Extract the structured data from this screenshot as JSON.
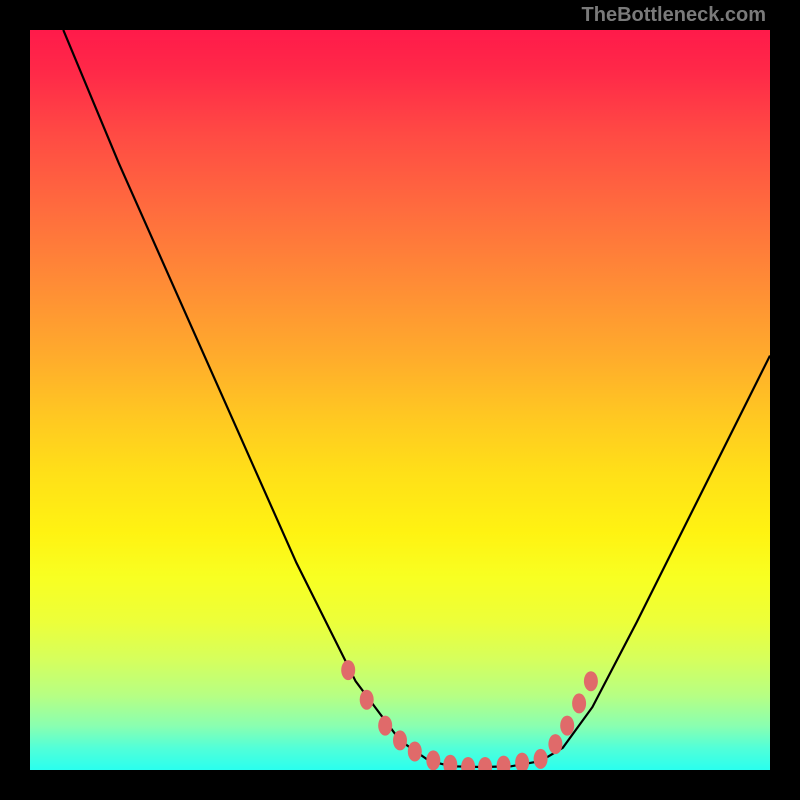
{
  "watermark": "TheBottleneck.com",
  "colors": {
    "frame": "#000000",
    "gradient_top": "#ff1a4a",
    "gradient_bottom": "#2affee",
    "curve": "#000000",
    "dot": "#e06a6a"
  },
  "chart_data": {
    "type": "line",
    "title": "",
    "xlabel": "",
    "ylabel": "",
    "xlim": [
      0,
      1
    ],
    "ylim": [
      0,
      1
    ],
    "note": "No axes or tick labels are visible; x and y are normalized to the plot area. y=1 is top of gradient, y=0 is bottom.",
    "series": [
      {
        "name": "curve",
        "x": [
          0.045,
          0.12,
          0.2,
          0.28,
          0.36,
          0.44,
          0.5,
          0.54,
          0.57,
          0.61,
          0.65,
          0.69,
          0.72,
          0.76,
          0.82,
          0.9,
          1.0
        ],
        "y": [
          1.0,
          0.82,
          0.64,
          0.46,
          0.28,
          0.12,
          0.04,
          0.012,
          0.005,
          0.004,
          0.005,
          0.012,
          0.03,
          0.085,
          0.2,
          0.36,
          0.56
        ]
      }
    ],
    "highlight_points": {
      "name": "dots",
      "x": [
        0.43,
        0.455,
        0.48,
        0.5,
        0.52,
        0.545,
        0.568,
        0.592,
        0.615,
        0.64,
        0.665,
        0.69,
        0.71,
        0.726,
        0.742,
        0.758
      ],
      "y": [
        0.135,
        0.095,
        0.06,
        0.04,
        0.025,
        0.013,
        0.007,
        0.004,
        0.004,
        0.006,
        0.01,
        0.015,
        0.035,
        0.06,
        0.09,
        0.12
      ]
    }
  }
}
